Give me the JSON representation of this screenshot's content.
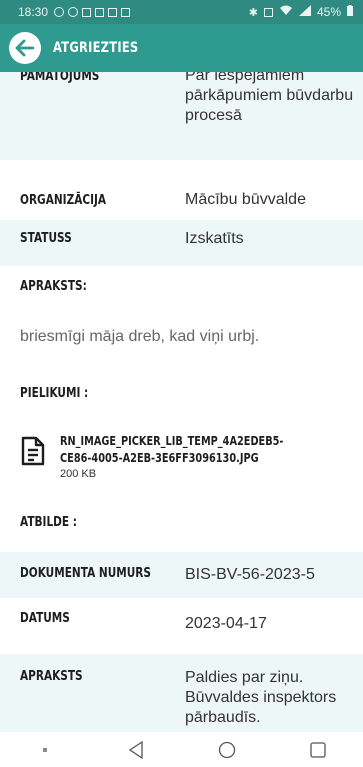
{
  "status_bar": {
    "time": "18:30",
    "battery": "45%"
  },
  "app_bar": {
    "title": "ATGRIEZTIES"
  },
  "details": {
    "pamatojums_label": "PAMATOJUMS",
    "pamatojums_value": "Par iespējamiem pārkāpumiem būvdarbu procesā",
    "organizacija_label": "ORGANIZĀCIJA",
    "organizacija_value": "Mācību būvvalde",
    "statuss_label": "STATUSS",
    "statuss_value": "Izskatīts",
    "apraksts_label": "APRAKSTS:",
    "apraksts_value": "briesmīgi māja dreb, kad viņi urbj.",
    "pielikumi_label": "PIELIKUMI :",
    "attachment": {
      "file_name": "RN_IMAGE_PICKER_LIB_TEMP_4A2EDEB5-CE86-4005-A2EB-3E6FF3096130.JPG",
      "file_size": "200 KB",
      "icon": "document-icon"
    }
  },
  "response": {
    "atbilde_label": "ATBILDE :",
    "doc_num_label": "DOKUMENTA NUMURS",
    "doc_num_value": "BIS-BV-56-2023-5",
    "datums_label": "DATUMS",
    "datums_value": "2023-04-17",
    "apraksts_label": "APRAKSTS",
    "apraksts_value": "Paldies par ziņu. Būvvaldes inspektors pārbaudīs."
  },
  "nav": {
    "icons": [
      "menu-dot-icon",
      "back-triangle-icon",
      "home-circle-icon",
      "recents-square-icon"
    ]
  },
  "colors": {
    "status_bar": "#2f8b82",
    "app_bar": "#2f9a8f",
    "row_shade": "#eef7f7"
  }
}
